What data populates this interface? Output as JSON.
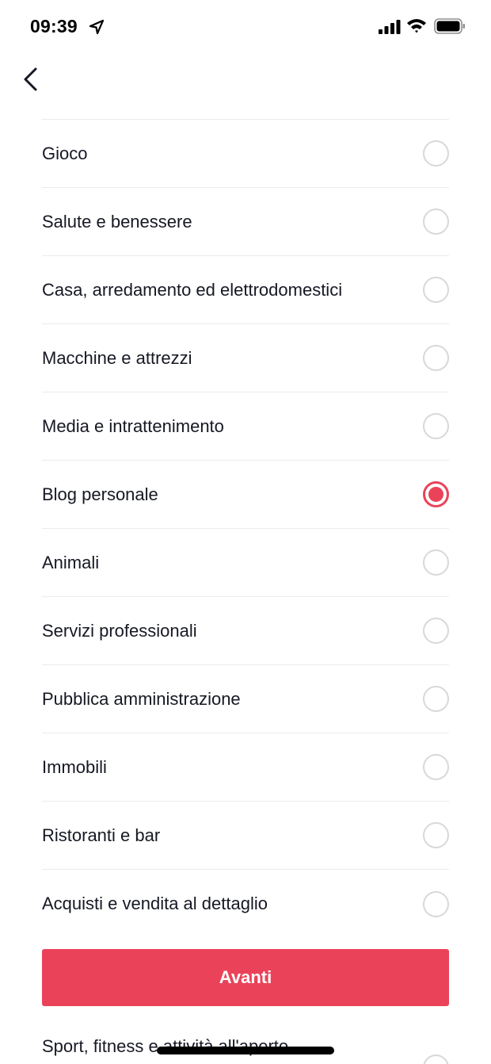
{
  "status_bar": {
    "time": "09:39",
    "location_icon": "location-arrow-icon",
    "signal_icon": "cellular-signal-icon",
    "wifi_icon": "wifi-icon",
    "battery_icon": "battery-icon"
  },
  "nav": {
    "back_icon": "chevron-left-icon"
  },
  "options": [
    {
      "label": "Gioco",
      "selected": false
    },
    {
      "label": "Salute e benessere",
      "selected": false
    },
    {
      "label": "Casa, arredamento ed elettrodomestici",
      "selected": false
    },
    {
      "label": "Macchine e attrezzi",
      "selected": false
    },
    {
      "label": "Media e intrattenimento",
      "selected": false
    },
    {
      "label": "Blog personale",
      "selected": true
    },
    {
      "label": "Animali",
      "selected": false
    },
    {
      "label": "Servizi professionali",
      "selected": false
    },
    {
      "label": "Pubblica amministrazione",
      "selected": false
    },
    {
      "label": "Immobili",
      "selected": false
    },
    {
      "label": "Ristoranti e bar",
      "selected": false
    },
    {
      "label": "Acquisti e vendita al dettaglio",
      "selected": false
    }
  ],
  "partial_option": {
    "label": "Sport, fitness e attività all'aperto"
  },
  "footer": {
    "next_label": "Avanti"
  },
  "colors": {
    "accent": "#ea4359",
    "text": "#161823",
    "divider": "#ebebec",
    "radio_border": "#d8d8da"
  }
}
